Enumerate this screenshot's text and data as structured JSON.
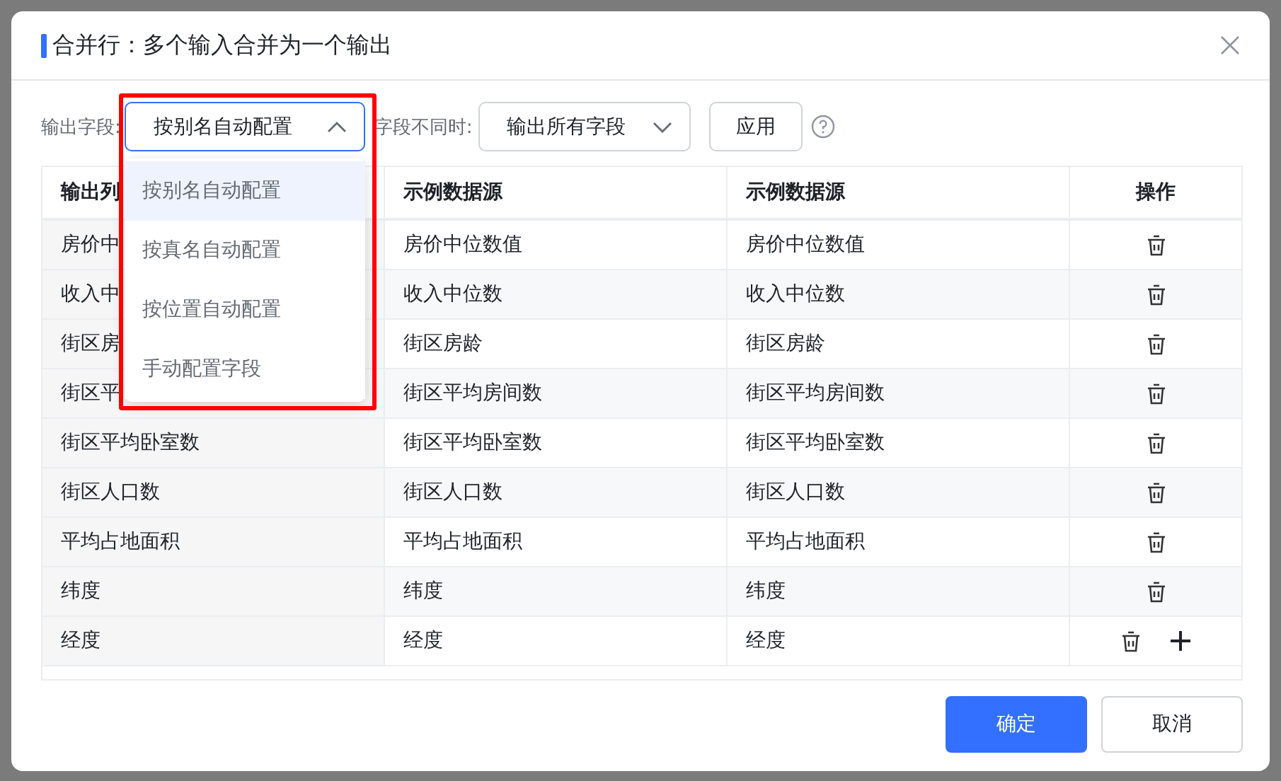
{
  "dialog": {
    "title": "合并行：多个输入合并为一个输出"
  },
  "toolbar": {
    "field_mapping": {
      "label": "输出字段:",
      "value": "按别名自动配置",
      "open": true,
      "highlighted": true,
      "options": [
        {
          "label": "按别名自动配置",
          "selected": true
        },
        {
          "label": "按真名自动配置",
          "selected": false
        },
        {
          "label": "按位置自动配置",
          "selected": false
        },
        {
          "label": "手动配置字段",
          "selected": false
        }
      ]
    },
    "mismatch": {
      "label": "字段不同时:",
      "value": "输出所有字段"
    },
    "apply_button": "应用"
  },
  "table": {
    "columns": [
      "输出列",
      "示例数据源",
      "示例数据源",
      "操作"
    ],
    "rows": [
      {
        "cells": [
          "房价中",
          "房价中位数值",
          "房价中位数值"
        ],
        "has_add": false
      },
      {
        "cells": [
          "收入中",
          "收入中位数",
          "收入中位数"
        ],
        "has_add": false
      },
      {
        "cells": [
          "街区房",
          "街区房龄",
          "街区房龄"
        ],
        "has_add": false
      },
      {
        "cells": [
          "街区平",
          "街区平均房间数",
          "街区平均房间数"
        ],
        "has_add": false
      },
      {
        "cells": [
          "街区平均卧室数",
          "街区平均卧室数",
          "街区平均卧室数"
        ],
        "has_add": false
      },
      {
        "cells": [
          "街区人口数",
          "街区人口数",
          "街区人口数"
        ],
        "has_add": false
      },
      {
        "cells": [
          "平均占地面积",
          "平均占地面积",
          "平均占地面积"
        ],
        "has_add": false
      },
      {
        "cells": [
          "纬度",
          "纬度",
          "纬度"
        ],
        "has_add": false
      },
      {
        "cells": [
          "经度",
          "经度",
          "经度"
        ],
        "has_add": true
      }
    ]
  },
  "footer": {
    "buttons": [
      {
        "label": "确定",
        "kind": "primary"
      },
      {
        "label": "取消",
        "kind": "secondary"
      }
    ]
  }
}
